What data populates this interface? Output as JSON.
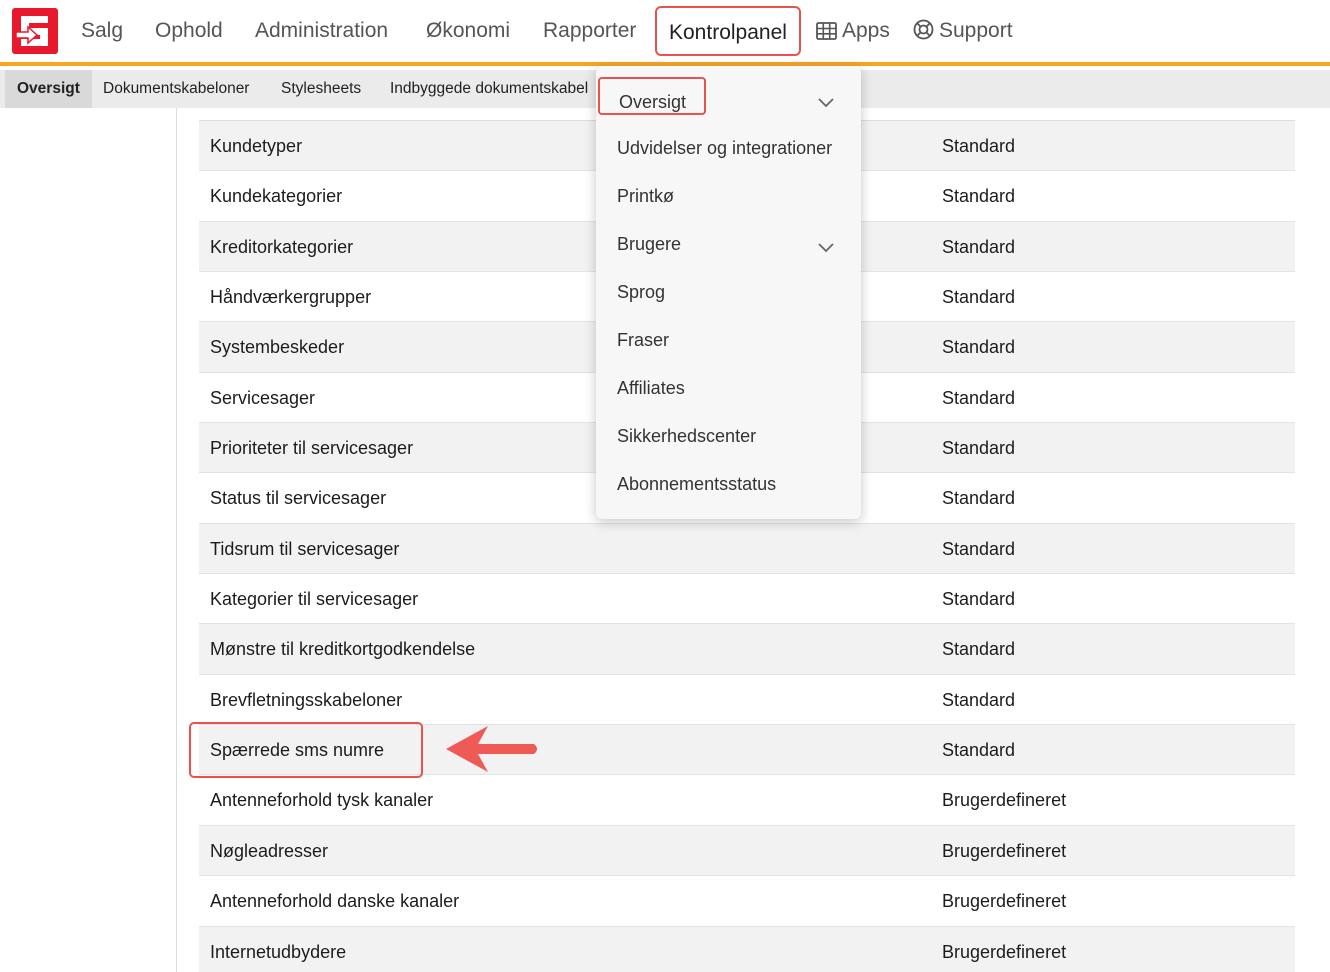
{
  "nav": {
    "logo_icon": "logo-icon",
    "items": [
      {
        "label": "Salg"
      },
      {
        "label": "Ophold"
      },
      {
        "label": "Administration"
      },
      {
        "label": "Økonomi"
      },
      {
        "label": "Rapporter"
      },
      {
        "label": "Kontrolpanel",
        "active": true
      },
      {
        "label": "Apps",
        "icon": "grid-icon"
      },
      {
        "label": "Support",
        "icon": "lifebuoy-icon"
      }
    ]
  },
  "subnav": {
    "items": [
      {
        "label": "Oversigt",
        "active": true
      },
      {
        "label": "Dokumentskabeloner"
      },
      {
        "label": "Stylesheets"
      },
      {
        "label": "Indbyggede dokumentskabel"
      }
    ]
  },
  "dropdown": {
    "items": [
      {
        "label": "Oversigt",
        "has_chevron": true
      },
      {
        "label": "Udvidelser og integrationer"
      },
      {
        "label": "Printkø"
      },
      {
        "label": "Brugere",
        "has_chevron": true
      },
      {
        "label": "Sprog"
      },
      {
        "label": "Fraser"
      },
      {
        "label": "Affiliates"
      },
      {
        "label": "Sikkerhedscenter"
      },
      {
        "label": "Abonnementsstatus"
      }
    ]
  },
  "table": {
    "rows": [
      {
        "name": "Kundetyper",
        "type": "Standard"
      },
      {
        "name": "Kundekategorier",
        "type": "Standard"
      },
      {
        "name": "Kreditorkategorier",
        "type": "Standard"
      },
      {
        "name": "Håndværkergrupper",
        "type": "Standard"
      },
      {
        "name": "Systembeskeder",
        "type": "Standard"
      },
      {
        "name": "Servicesager",
        "type": "Standard"
      },
      {
        "name": "Prioriteter til servicesager",
        "type": "Standard"
      },
      {
        "name": "Status til servicesager",
        "type": "Standard"
      },
      {
        "name": "Tidsrum til servicesager",
        "type": "Standard"
      },
      {
        "name": "Kategorier til servicesager",
        "type": "Standard"
      },
      {
        "name": "Mønstre til kreditkortgodkendelse",
        "type": "Standard"
      },
      {
        "name": "Brevfletningsskabeloner",
        "type": "Standard"
      },
      {
        "name": "Spærrede sms numre",
        "type": "Standard"
      },
      {
        "name": "Antenneforhold tysk kanaler",
        "type": "Brugerdefineret"
      },
      {
        "name": "Nøgleadresser",
        "type": "Brugerdefineret"
      },
      {
        "name": "Antenneforhold danske kanaler",
        "type": "Brugerdefineret"
      },
      {
        "name": "Internetudbydere",
        "type": "Brugerdefineret"
      }
    ]
  },
  "colors": {
    "brand": "#e8192c",
    "accent_bar": "#f5a623",
    "annotation": "#e8524f"
  }
}
